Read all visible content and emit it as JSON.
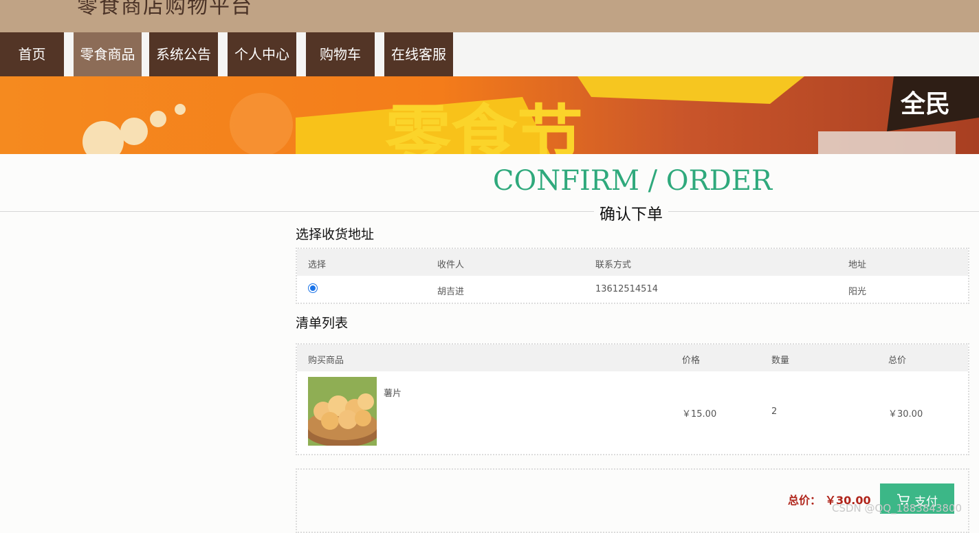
{
  "header": {
    "site_title": "零食商店购物平台"
  },
  "nav": {
    "items": [
      {
        "label": "首页"
      },
      {
        "label": "零食商品"
      },
      {
        "label": "系统公告"
      },
      {
        "label": "个人中心"
      },
      {
        "label": "购物车"
      },
      {
        "label": "在线客服"
      }
    ],
    "active_index": 1
  },
  "banner": {
    "text": "零食节"
  },
  "page": {
    "heading_en": "CONFIRM / ORDER",
    "heading_cn": "确认下单"
  },
  "address": {
    "section_title": "选择收货地址",
    "columns": [
      "选择",
      "收件人",
      "联系方式",
      "地址"
    ],
    "rows": [
      {
        "selected": true,
        "recipient": "胡吉进",
        "phone": "13612514514",
        "address": "阳光"
      }
    ]
  },
  "items": {
    "section_title": "清单列表",
    "columns": [
      "购买商品",
      "价格",
      "数量",
      "总价"
    ],
    "rows": [
      {
        "name": "薯片",
        "price": "￥15.00",
        "quantity": "2",
        "total": "￥30.00"
      }
    ]
  },
  "summary": {
    "total_label": "总价：",
    "total_value": "￥30.00",
    "pay_label": "支付"
  },
  "watermark": "CSDN @QQ_1883843800",
  "colors": {
    "accent": "#3cb787",
    "nav": "#533526",
    "nav_active": "#8c6c57",
    "topbar": "#c0a385",
    "price_red": "#b0251b"
  }
}
